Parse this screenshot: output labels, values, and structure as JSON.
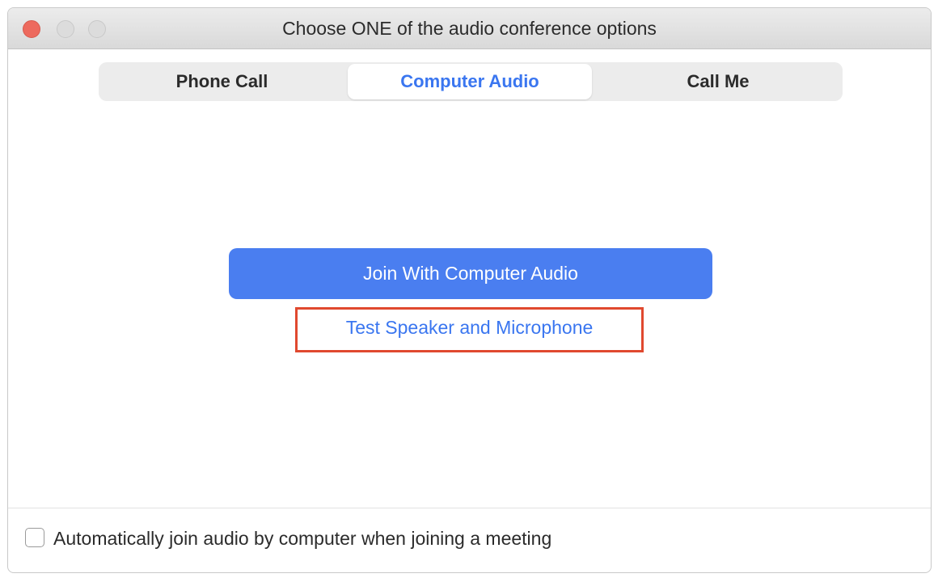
{
  "window": {
    "title": "Choose ONE of the audio conference options"
  },
  "tabs": [
    {
      "label": "Phone Call",
      "selected": false
    },
    {
      "label": "Computer Audio",
      "selected": true
    },
    {
      "label": "Call Me",
      "selected": false
    }
  ],
  "main": {
    "join_button_label": "Join With Computer Audio",
    "test_link_label": "Test Speaker and Microphone"
  },
  "footer": {
    "auto_join_checked": false,
    "auto_join_label": "Automatically join audio by computer when joining a meeting"
  },
  "colors": {
    "accent": "#3a76f0",
    "button": "#4a7ef0",
    "highlight_box": "#e0492f",
    "close_dot": "#ed6a5e"
  }
}
